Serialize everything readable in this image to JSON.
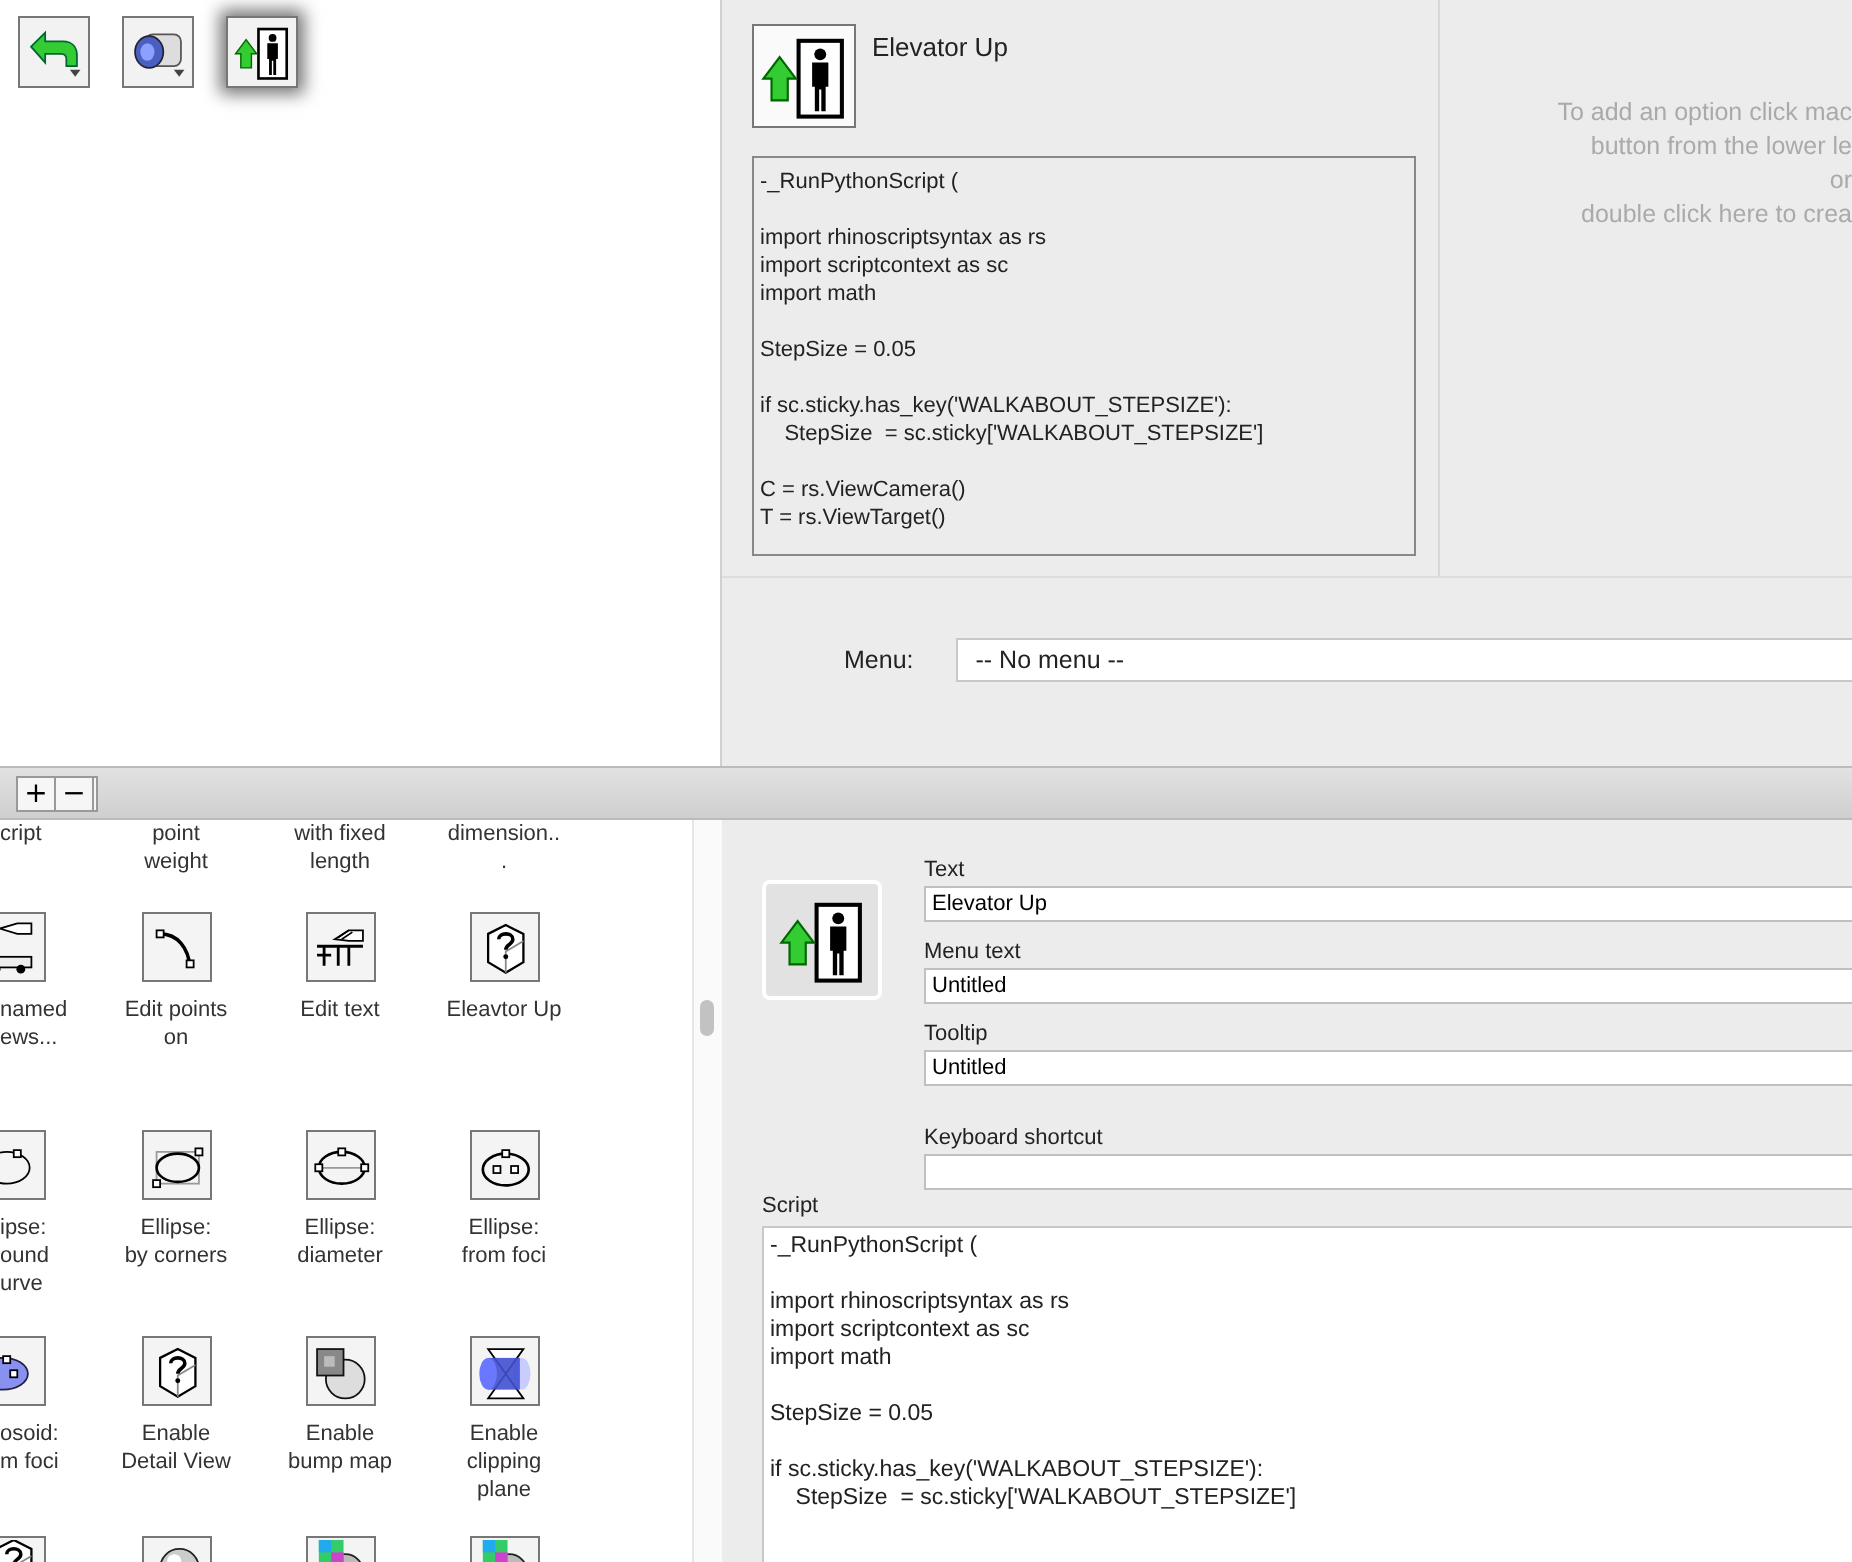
{
  "toolbar_buttons": [
    {
      "selected": false
    },
    {
      "selected": false
    },
    {
      "selected": true
    }
  ],
  "command_preview": {
    "title": "Elevator Up",
    "script": "-_RunPythonScript (\n\nimport rhinoscriptsyntax as rs\nimport scriptcontext as sc\nimport math\n\nStepSize = 0.05\n\nif sc.sticky.has_key('WALKABOUT_STEPSIZE'):\n    StepSize  = sc.sticky['WALKABOUT_STEPSIZE']\n\nC = rs.ViewCamera()\nT = rs.ViewTarget()"
  },
  "options_hint": [
    "To add an option click mac",
    "button from the lower le",
    "or",
    "double click here to crea"
  ],
  "menu": {
    "label": "Menu:",
    "value": "-- No menu --"
  },
  "list_buttons": [
    "+",
    "−"
  ],
  "command_grid": {
    "rows": [
      {
        "items": [
          {
            "kind": "label_only",
            "label": "cript"
          },
          {
            "kind": "label_only",
            "label": "point\nweight"
          },
          {
            "kind": "label_only",
            "label": "with fixed\nlength"
          },
          {
            "kind": "label_only",
            "label": "dimension..\n."
          }
        ]
      },
      {
        "items": [
          {
            "kind": "full",
            "label": "named\news..."
          },
          {
            "kind": "full",
            "label": "Edit points\non"
          },
          {
            "kind": "full",
            "label": "Edit text"
          },
          {
            "kind": "full",
            "label": "Eleavtor Up"
          }
        ]
      },
      {
        "items": [
          {
            "kind": "full",
            "label": "ipse:\nound\nurve"
          },
          {
            "kind": "full",
            "label": "Ellipse:\nby corners"
          },
          {
            "kind": "full",
            "label": "Ellipse:\ndiameter"
          },
          {
            "kind": "full",
            "label": "Ellipse:\nfrom foci"
          }
        ]
      },
      {
        "items": [
          {
            "kind": "full",
            "label": "osoid:\nm foci"
          },
          {
            "kind": "full",
            "label": "Enable\nDetail View"
          },
          {
            "kind": "full",
            "label": "Enable\nbump map"
          },
          {
            "kind": "full",
            "label": "Enable\nclipping\nplane"
          }
        ]
      },
      {
        "items": [
          {
            "kind": "icon_only"
          },
          {
            "kind": "icon_only"
          },
          {
            "kind": "icon_only"
          },
          {
            "kind": "icon_only"
          }
        ]
      }
    ]
  },
  "editor": {
    "fields": [
      {
        "label": "Text",
        "value": "Elevator Up"
      },
      {
        "label": "Menu text",
        "value": "Untitled"
      },
      {
        "label": "Tooltip",
        "value": "Untitled"
      },
      {
        "label": "Keyboard shortcut"
      }
    ],
    "script_label": "Script",
    "script": "-_RunPythonScript (\n\nimport rhinoscriptsyntax as rs\nimport scriptcontext as sc\nimport math\n\nStepSize = 0.05\n\nif sc.sticky.has_key('WALKABOUT_STEPSIZE'):\n    StepSize  = sc.sticky['WALKABOUT_STEPSIZE']"
  }
}
